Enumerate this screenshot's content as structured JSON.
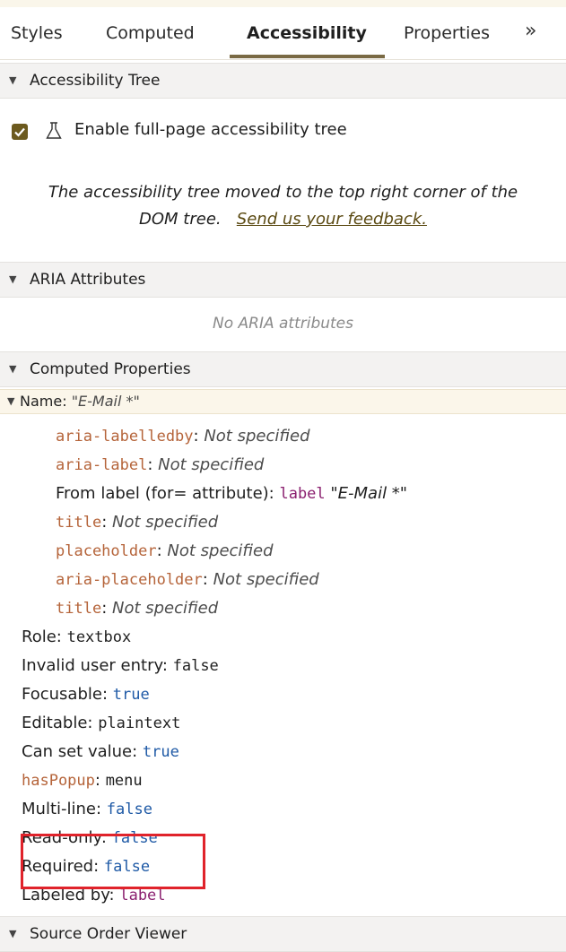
{
  "tabs": [
    {
      "label": "Styles"
    },
    {
      "label": "Computed"
    },
    {
      "label": "Accessibility"
    },
    {
      "label": "Properties"
    }
  ],
  "tabs_more": "»",
  "sections": {
    "accessibility_tree": "Accessibility Tree",
    "aria_attributes": "ARIA Attributes",
    "computed_properties": "Computed Properties",
    "source_order": "Source Order Viewer"
  },
  "a11y_tree": {
    "checkbox_label": "Enable full-page accessibility tree",
    "note_line1": "The accessibility tree moved to the top right corner of the",
    "note_line2_prefix": "DOM tree.",
    "feedback_link": "Send us your feedback."
  },
  "aria": {
    "empty": "No ARIA attributes"
  },
  "name_row": {
    "label": "Name: ",
    "value": "\"E-Mail *\""
  },
  "name_sources": [
    {
      "attr": "aria-labelledby",
      "sep": ": ",
      "value": "Not specified"
    },
    {
      "attr": "aria-label",
      "sep": ": ",
      "value": "Not specified"
    },
    {
      "attr": "title",
      "sep": ": ",
      "value": "Not specified"
    },
    {
      "attr": "placeholder",
      "sep": ": ",
      "value": "Not specified"
    },
    {
      "attr": "aria-placeholder",
      "sep": ": ",
      "value": "Not specified"
    },
    {
      "attr": "title",
      "sep": ": ",
      "value": "Not specified"
    }
  ],
  "from_label": {
    "label": "From label (for= attribute): ",
    "kw": "label",
    "value": " \"E-Mail *\""
  },
  "properties": [
    {
      "label": "Role: ",
      "value": "textbox"
    },
    {
      "label": "Invalid user entry: ",
      "value": "false"
    },
    {
      "label": "Focusable: ",
      "value": "true"
    },
    {
      "label": "Editable: ",
      "value": "plaintext"
    },
    {
      "label": "Can set value: ",
      "value": "true"
    },
    {
      "label": "hasPopup",
      "sep": ": ",
      "value": "menu"
    },
    {
      "label": "Multi-line: ",
      "value": "false"
    },
    {
      "label": "Read-only: ",
      "value": "false"
    },
    {
      "label": "Required: ",
      "value": "false"
    },
    {
      "label": "Labeled by: ",
      "value": "label"
    }
  ],
  "colors": {
    "accent": "#7a6a44",
    "attr": "#b5643a",
    "keyword": "#8a1f6f",
    "boolean": "#1f5aa6",
    "highlight": "#e0232b"
  }
}
